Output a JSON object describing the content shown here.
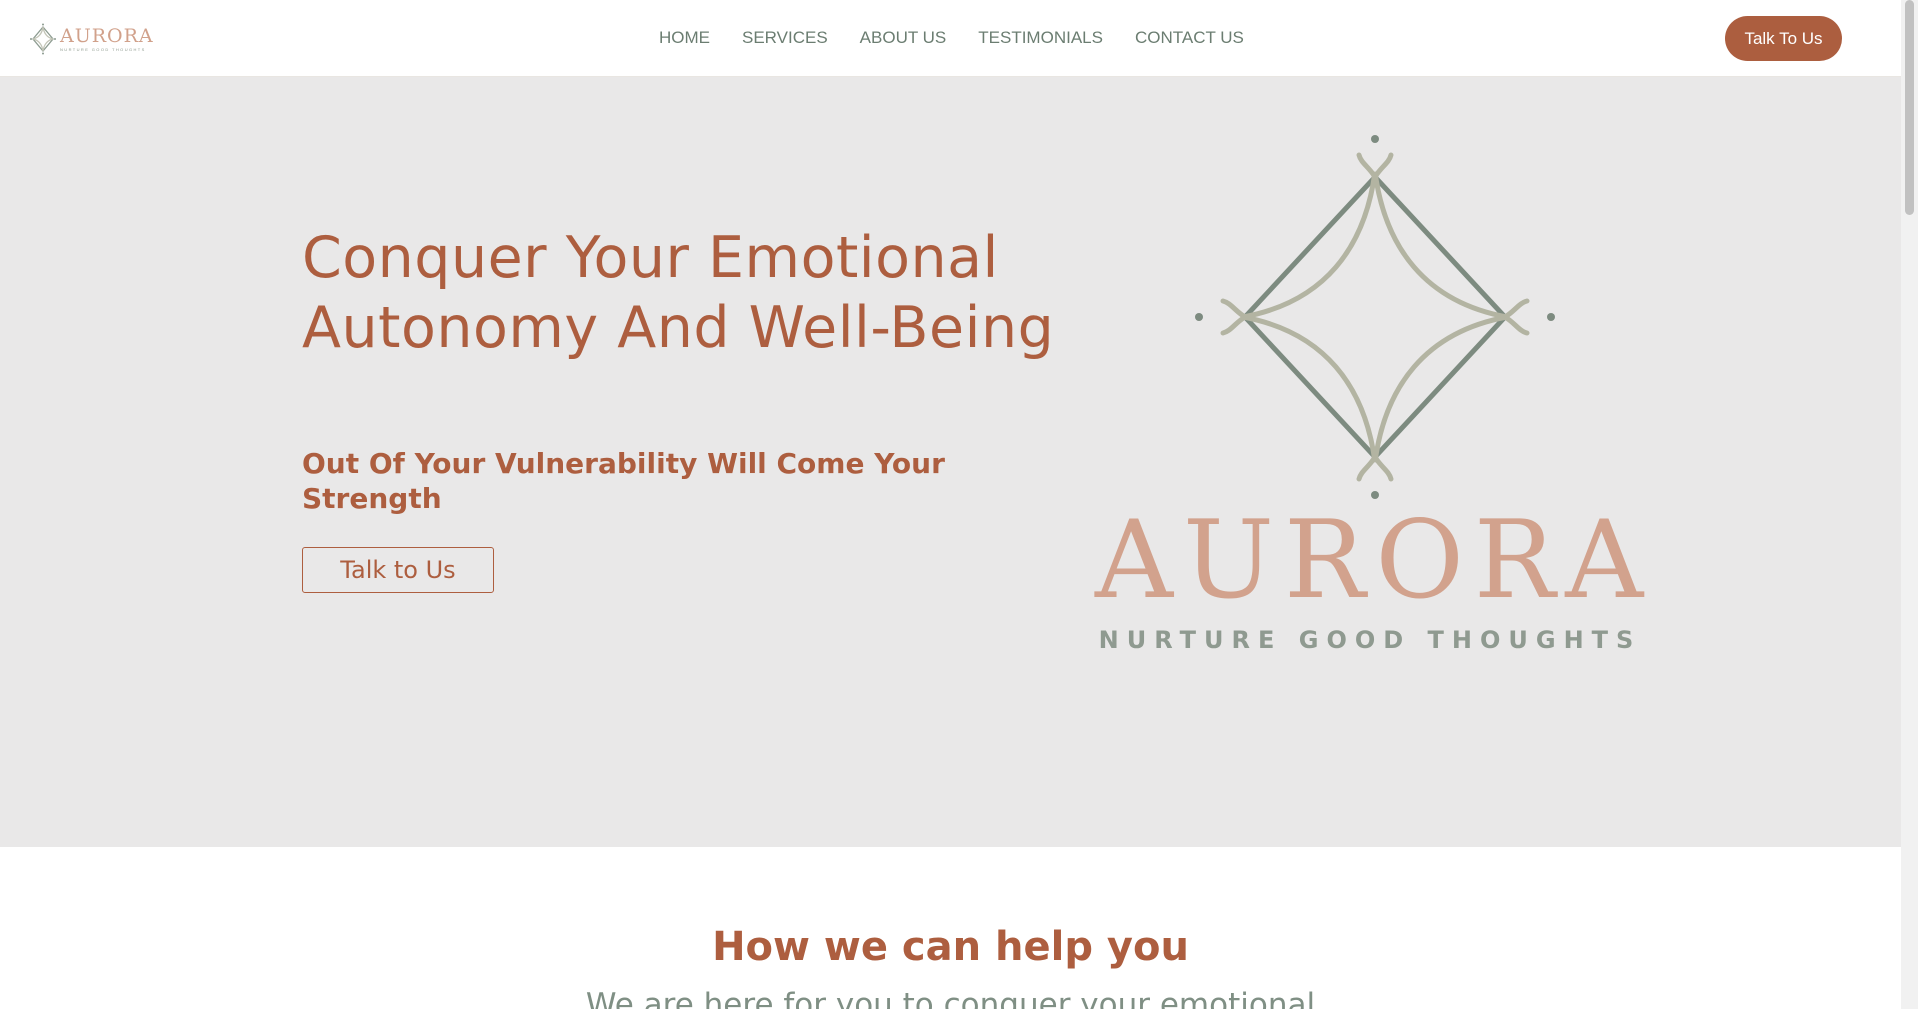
{
  "brand": {
    "name": "AURORA",
    "tagline": "NURTURE GOOD THOUGHTS"
  },
  "nav": {
    "items": [
      "HOME",
      "SERVICES",
      "ABOUT US",
      "TESTIMONIALS",
      "CONTACT US"
    ]
  },
  "header": {
    "cta_label": "Talk To Us"
  },
  "hero": {
    "title": "Conquer Your Emotional Autonomy And Well-Being",
    "subtitle": "Out Of Your Vulnerability Will Come Your Strength",
    "cta_label": "Talk to Us",
    "logo_word": "AURORA",
    "logo_tagline": "NURTURE GOOD THOUGHTS"
  },
  "help": {
    "title": "How we can help you",
    "lead": "We are here for you to conquer your emotional"
  },
  "colors": {
    "accent": "#ac5e3f",
    "hero_background": "#e9e8e8",
    "nav_text": "#6b7d71",
    "logo_peach": "#d2a28d",
    "logo_sage": "#8f9a90"
  },
  "icons": {
    "header_logo": "aurora-star-icon",
    "hero_emblem": "aurora-emblem-icon"
  }
}
